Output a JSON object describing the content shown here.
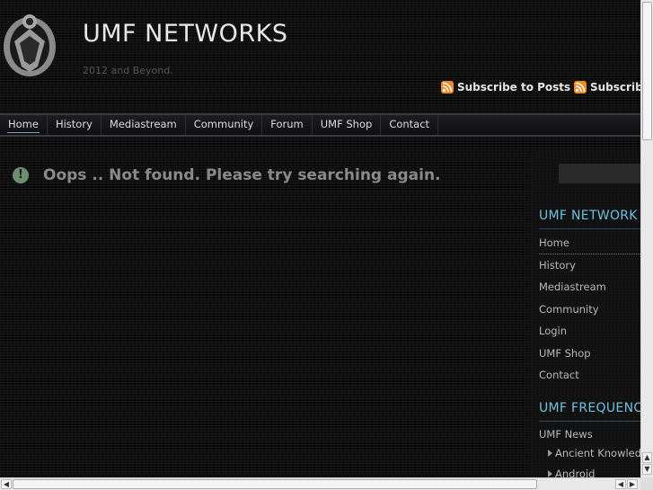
{
  "header": {
    "title": "UMF NETWORKS",
    "tagline": "2012 and Beyond.",
    "subscribe_posts": "Subscribe to Posts",
    "subscribe_comments": "Subscribe to Comments",
    "rss_color": "#f08a24"
  },
  "nav": {
    "items": [
      {
        "label": "Home"
      },
      {
        "label": "History"
      },
      {
        "label": "Mediastream"
      },
      {
        "label": "Community"
      },
      {
        "label": "Forum"
      },
      {
        "label": "UMF Shop"
      },
      {
        "label": "Contact"
      }
    ]
  },
  "main": {
    "message": "Oops .. Not found. Please try searching again.",
    "icon": "exclamation-icon"
  },
  "sidebar": {
    "search_value": "",
    "widget1_title": "UMF NETWORK",
    "widget1_links": [
      {
        "label": "Home"
      },
      {
        "label": "History"
      },
      {
        "label": "Mediastream"
      },
      {
        "label": "Community"
      },
      {
        "label": "Login"
      },
      {
        "label": "UMF Shop"
      },
      {
        "label": "Contact"
      }
    ],
    "widget2_title": "UMF FREQUENCY",
    "widget2_links": [
      {
        "label": "UMF News"
      }
    ],
    "widget2_sub": [
      {
        "label": "Ancient Knowledge"
      },
      {
        "label": "Android"
      }
    ]
  },
  "colors": {
    "accent": "#6fc1e0",
    "background": "#0c0c0c"
  }
}
